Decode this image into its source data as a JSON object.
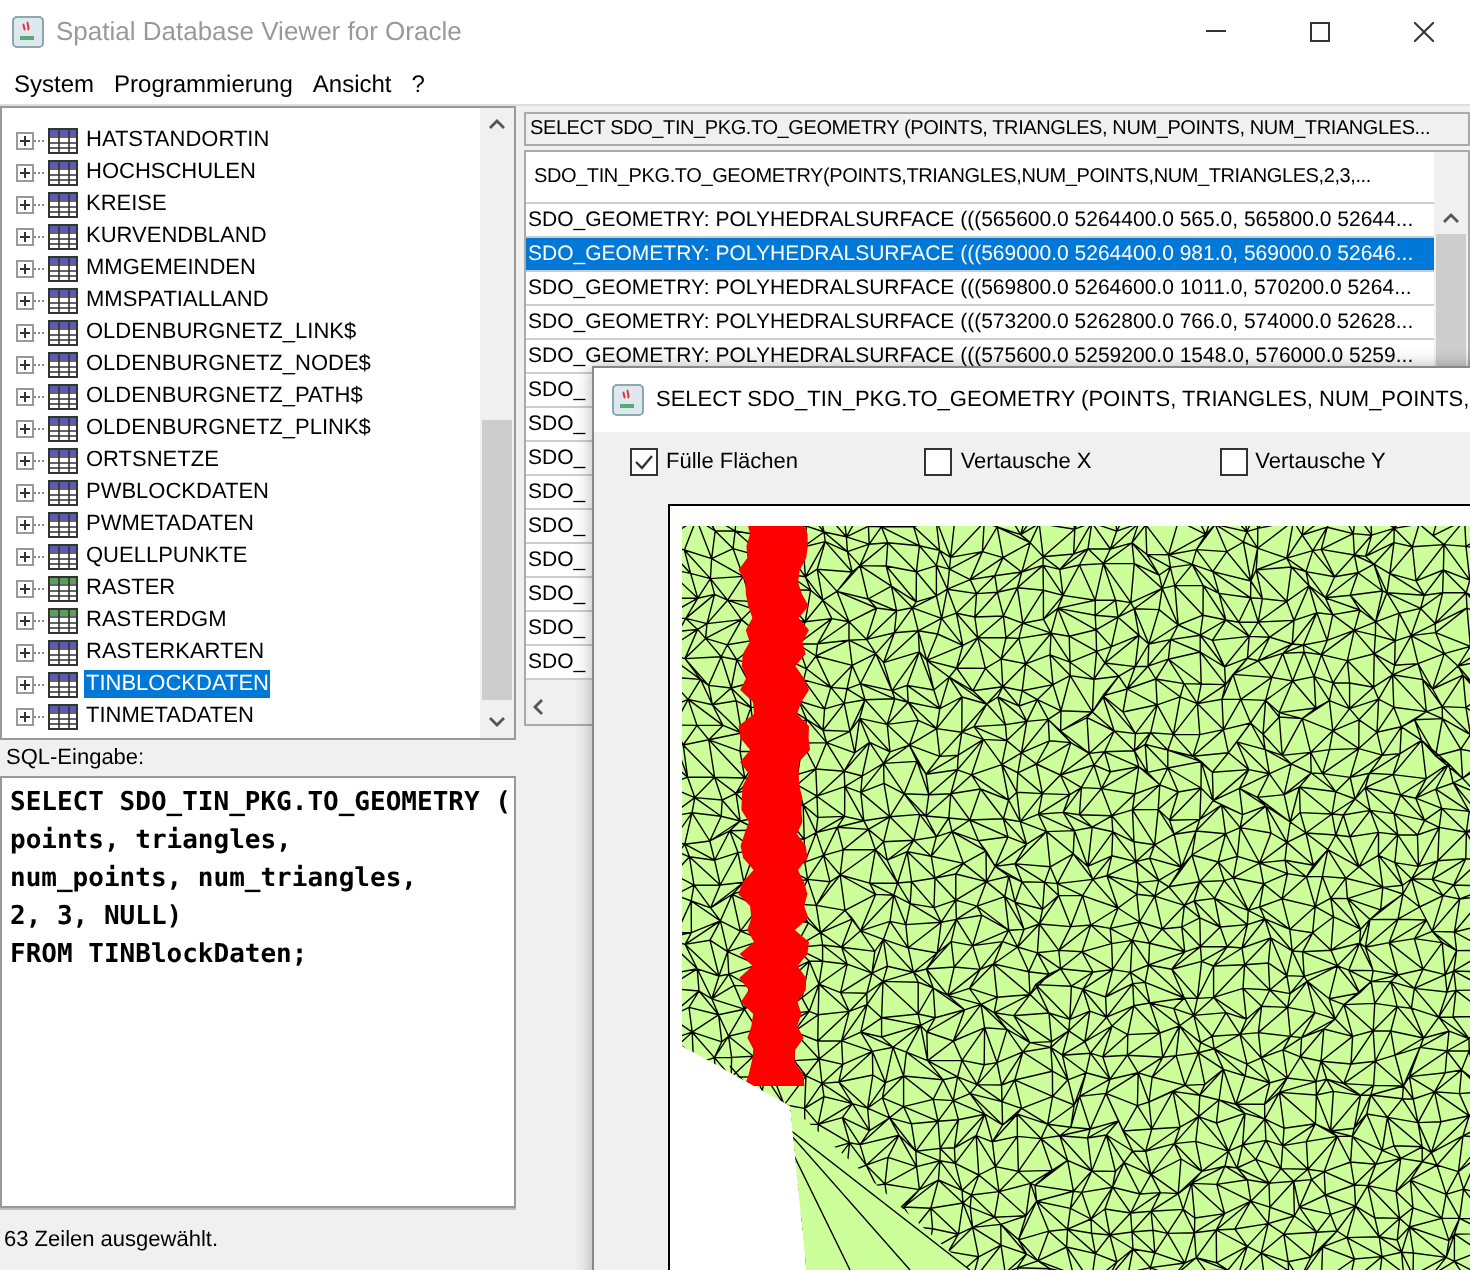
{
  "window": {
    "title": "Spatial Database Viewer for Oracle"
  },
  "menu": [
    "System",
    "Programmierung",
    "Ansicht",
    "?"
  ],
  "tree": {
    "items": [
      {
        "label": "HATSTANDORTIN",
        "selected": false,
        "color": "#5a5ab4"
      },
      {
        "label": "HOCHSCHULEN",
        "selected": false,
        "color": "#5a5ab4"
      },
      {
        "label": "KREISE",
        "selected": false,
        "color": "#5a5ab4"
      },
      {
        "label": "KURVENDBLAND",
        "selected": false,
        "color": "#5a5ab4"
      },
      {
        "label": "MMGEMEINDEN",
        "selected": false,
        "color": "#5a5ab4"
      },
      {
        "label": "MMSPATIALLAND",
        "selected": false,
        "color": "#5a5ab4"
      },
      {
        "label": "OLDENBURGNETZ_LINK$",
        "selected": false,
        "color": "#5a5ab4"
      },
      {
        "label": "OLDENBURGNETZ_NODE$",
        "selected": false,
        "color": "#5a5ab4"
      },
      {
        "label": "OLDENBURGNETZ_PATH$",
        "selected": false,
        "color": "#5a5ab4"
      },
      {
        "label": "OLDENBURGNETZ_PLINK$",
        "selected": false,
        "color": "#5a5ab4"
      },
      {
        "label": "ORTSNETZE",
        "selected": false,
        "color": "#5a5ab4"
      },
      {
        "label": "PWBLOCKDATEN",
        "selected": false,
        "color": "#5a5ab4"
      },
      {
        "label": "PWMETADATEN",
        "selected": false,
        "color": "#5a5ab4"
      },
      {
        "label": "QUELLPUNKTE",
        "selected": false,
        "color": "#5a5ab4"
      },
      {
        "label": "RASTER",
        "selected": false,
        "color": "#5aa05a"
      },
      {
        "label": "RASTERDGM",
        "selected": false,
        "color": "#5aa05a"
      },
      {
        "label": "RASTERKARTEN",
        "selected": false,
        "color": "#5a5ab4"
      },
      {
        "label": "TINBLOCKDATEN",
        "selected": true,
        "color": "#5a5ab4"
      },
      {
        "label": "TINMETADATEN",
        "selected": false,
        "color": "#5a5ab4"
      }
    ]
  },
  "result": {
    "query": "SELECT SDO_TIN_PKG.TO_GEOMETRY (POINTS, TRIANGLES, NUM_POINTS, NUM_TRIANGLES...",
    "column": "SDO_TIN_PKG.TO_GEOMETRY(POINTS,TRIANGLES,NUM_POINTS,NUM_TRIANGLES,2,3,...",
    "rows": [
      {
        "text": "SDO_GEOMETRY: POLYHEDRALSURFACE (((565600.0 5264400.0 565.0, 565800.0 52644...",
        "selected": false
      },
      {
        "text": "SDO_GEOMETRY: POLYHEDRALSURFACE (((569000.0 5264400.0 981.0, 569000.0 52646...",
        "selected": true
      },
      {
        "text": "SDO_GEOMETRY: POLYHEDRALSURFACE (((569800.0 5264600.0 1011.0, 570200.0 5264...",
        "selected": false
      },
      {
        "text": "SDO_GEOMETRY: POLYHEDRALSURFACE (((573200.0 5262800.0 766.0, 574000.0 52628...",
        "selected": false
      },
      {
        "text": "SDO_GEOMETRY: POLYHEDRALSURFACE (((575600.0 5259200.0 1548.0, 576000.0 5259...",
        "selected": false
      },
      {
        "text": "SDO_",
        "selected": false
      },
      {
        "text": "SDO_",
        "selected": false
      },
      {
        "text": "SDO_",
        "selected": false
      },
      {
        "text": "SDO_",
        "selected": false
      },
      {
        "text": "SDO_",
        "selected": false
      },
      {
        "text": "SDO_",
        "selected": false
      },
      {
        "text": "SDO_",
        "selected": false
      },
      {
        "text": "SDO_",
        "selected": false
      },
      {
        "text": "SDO_",
        "selected": false
      }
    ]
  },
  "sql": {
    "label": "SQL-Eingabe:",
    "lines": [
      "SELECT SDO_TIN_PKG.TO_GEOMETRY (",
      "points, triangles,",
      "num_points, num_triangles,",
      "2, 3, NULL)",
      "FROM TINBlockDaten;"
    ]
  },
  "status_bar": "63 Zeilen ausgewählt.",
  "dialog": {
    "title": "SELECT SDO_TIN_PKG.TO_GEOMETRY (POINTS, TRIANGLES, NUM_POINTS,",
    "options": [
      {
        "label": "Fülle Flächen",
        "checked": true
      },
      {
        "label": "Vertausche X",
        "checked": false
      },
      {
        "label": "Vertausche Y",
        "checked": false
      }
    ]
  }
}
